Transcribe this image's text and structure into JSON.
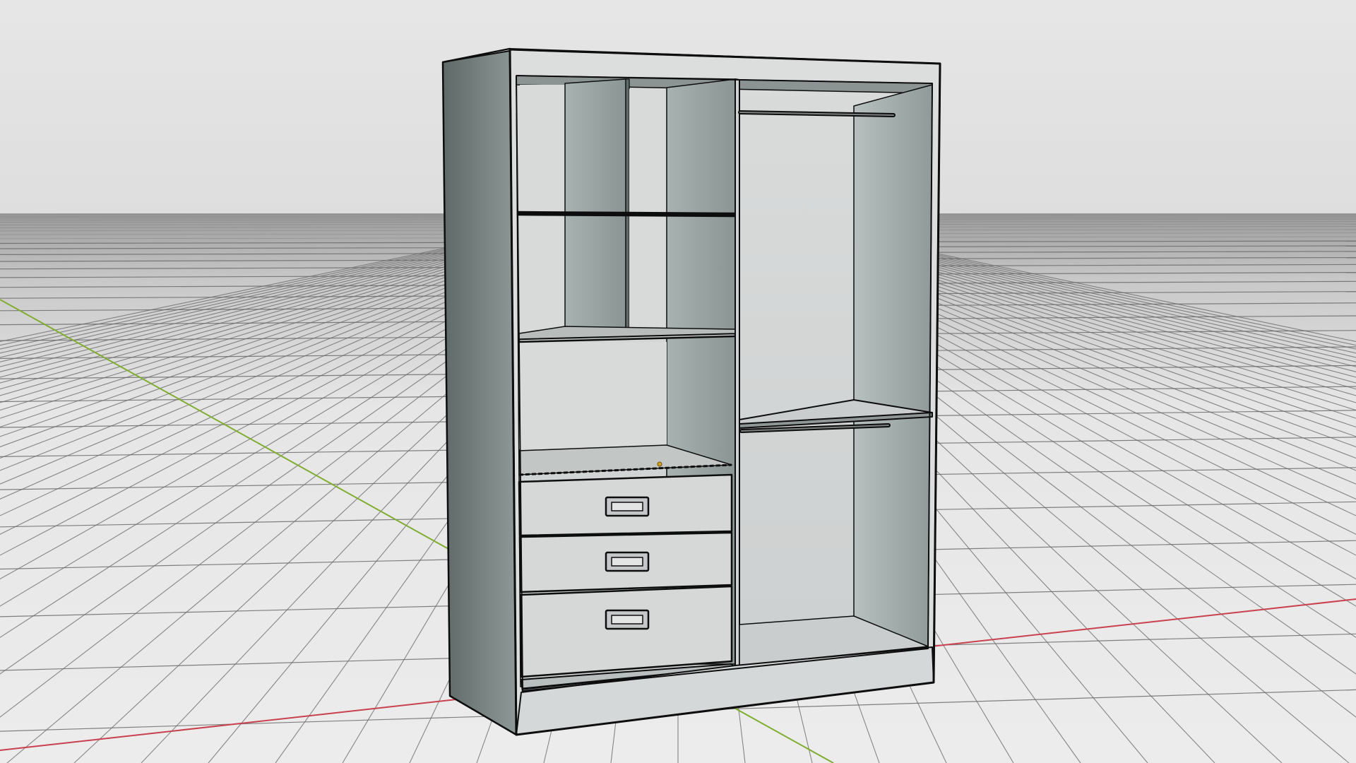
{
  "viewport": {
    "mode": "3d-perspective-solid-with-wire-edges",
    "background_sky": "#e4e4e4",
    "grid_color": "#6c6c6c",
    "floor_color": "#ebebeb",
    "x_axis_color": "#c9404f",
    "y_axis_color": "#7fae2e",
    "object_edge_color": "#0d0d0d"
  },
  "model": {
    "object": "wardrobe",
    "faces": {
      "front_face": "#dcdede",
      "side_face_light": "#a3aeac",
      "side_face_dark": "#6f7a79",
      "back_panel": "#d4d6d6",
      "inner_side": "#9ea9a8",
      "shelf_top": "#c9cdcd"
    },
    "left_compartment": {
      "shelves": 2,
      "vertical_divider_upper": true,
      "drawers": 3,
      "handle_icon": "drawer-pull-icon"
    },
    "right_compartment": {
      "hanging_rails": 2,
      "shelves": 1
    },
    "origin_marker_color": "#d8a21a"
  }
}
